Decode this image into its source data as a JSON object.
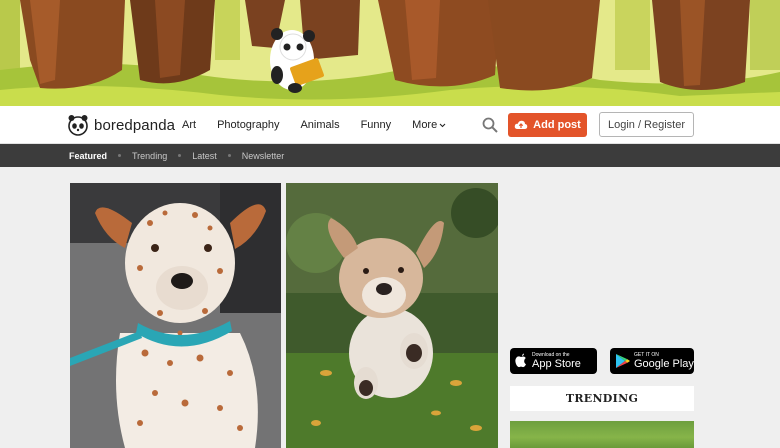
{
  "brand": {
    "name": "boredpanda"
  },
  "nav": {
    "items": [
      "Art",
      "Photography",
      "Animals",
      "Funny"
    ],
    "more_label": "More"
  },
  "actions": {
    "add_post_label": "Add post",
    "login_label": "Login / Register"
  },
  "subnav": {
    "items": [
      "Featured",
      "Trending",
      "Latest",
      "Newsletter"
    ],
    "active": "Featured"
  },
  "sidebar": {
    "app_store": {
      "small": "Download on the",
      "big": "App Store"
    },
    "google_play": {
      "small": "GET IT ON",
      "big": "Google Play"
    },
    "trending_title": "TRENDING"
  },
  "colors": {
    "accent": "#e3542a",
    "subnav_bg": "#3c3c3c",
    "page_bg": "#efefef"
  },
  "icons": [
    "panda-logo-icon",
    "search-icon",
    "cloud-upload-icon",
    "chevron-down-icon",
    "apple-icon",
    "google-play-icon"
  ]
}
